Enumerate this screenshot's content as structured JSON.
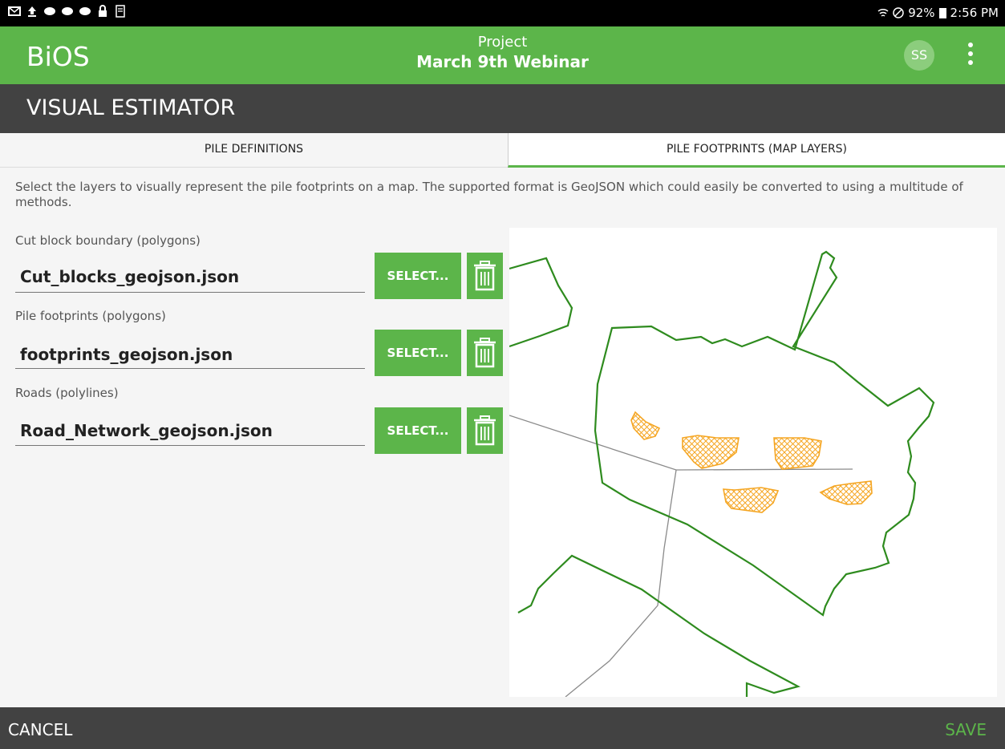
{
  "status_bar": {
    "battery": "92%",
    "time": "2:56 PM"
  },
  "app_bar": {
    "brand": "BiOS",
    "project_label": "Project",
    "project_name": "March 9th Webinar",
    "avatar_initials": "SS"
  },
  "section": {
    "title": "VISUAL ESTIMATOR"
  },
  "tabs": [
    {
      "label": "PILE DEFINITIONS",
      "active": false
    },
    {
      "label": "PILE FOOTPRINTS (MAP LAYERS)",
      "active": true
    }
  ],
  "description": "Select the layers to visually represent the pile footprints on a map. The supported format is GeoJSON which could easily be converted to using a multitude of methods.",
  "layers": [
    {
      "label": "Cut block boundary (polygons)",
      "value": "Cut_blocks_geojson.json",
      "select_label": "SELECT..."
    },
    {
      "label": "Pile footprints (polygons)",
      "value": "footprints_geojson.json",
      "select_label": "SELECT..."
    },
    {
      "label": "Roads (polylines)",
      "value": "Road_Network_geojson.json",
      "select_label": "SELECT..."
    }
  ],
  "footer": {
    "cancel_label": "CANCEL",
    "save_label": "SAVE"
  },
  "colors": {
    "accent": "#5cb54a",
    "boundary": "#2e8b1e",
    "pile": "#f5a623",
    "road": "#888888",
    "dark_bar": "#424242"
  }
}
